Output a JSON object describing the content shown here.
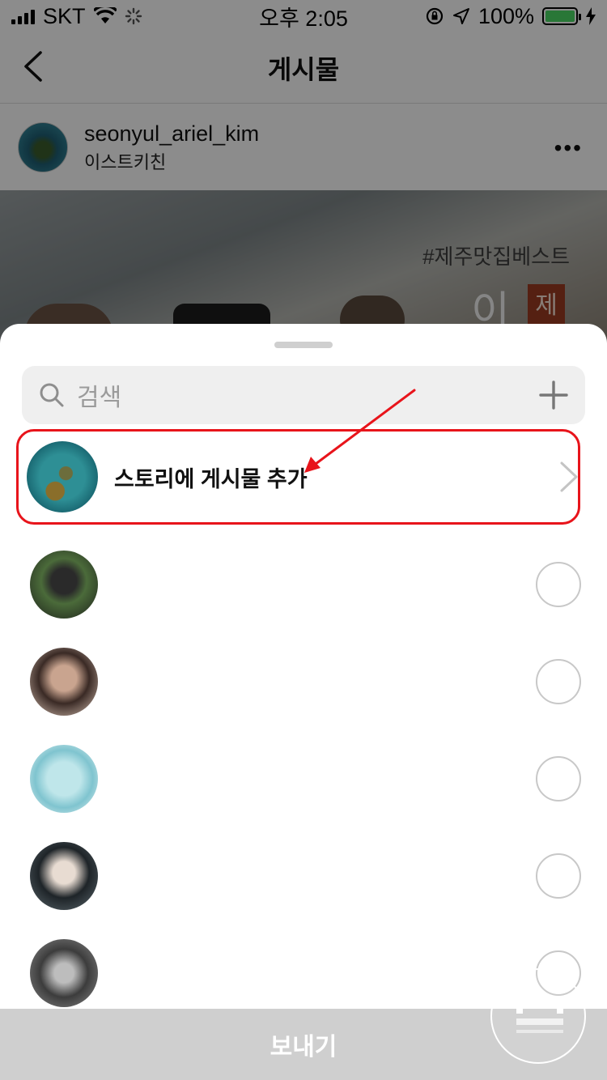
{
  "status_bar": {
    "carrier": "SKT",
    "time": "오후 2:05",
    "battery_percent": "100%",
    "battery_color": "#4cd964"
  },
  "nav": {
    "title": "게시물",
    "back_icon": "chevron-left-icon"
  },
  "post": {
    "username": "seonyul_ariel_kim",
    "location": "이스트키친",
    "more_icon": "more-icon",
    "image_overlay_text": "#제주맛집베스트",
    "image_big_char": "이",
    "image_red_char": "제"
  },
  "sheet": {
    "search_placeholder": "검색",
    "add_to_story_label": "스토리에 게시물 추가",
    "send_label": "보내기",
    "highlight_color": "#e8141b"
  },
  "contacts": [
    {
      "name": "",
      "subtitle": ""
    },
    {
      "name": "",
      "subtitle": ""
    },
    {
      "name": "",
      "subtitle": ""
    },
    {
      "name": "",
      "subtitle": ""
    },
    {
      "name": "",
      "subtitle": ""
    }
  ]
}
